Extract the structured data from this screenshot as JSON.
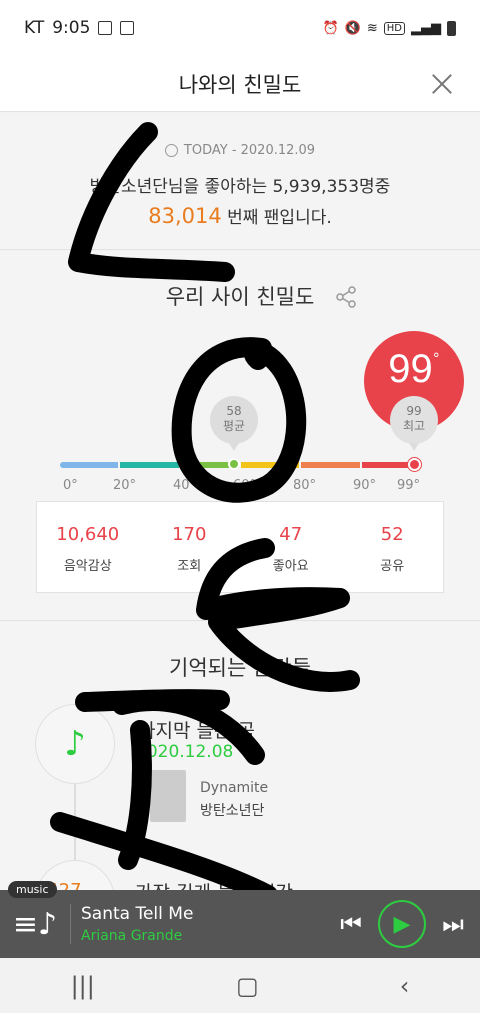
{
  "status_bar": {
    "carrier": "KT",
    "time": "9:05",
    "hd_badge": "HD"
  },
  "header": {
    "title": "나와의 친밀도"
  },
  "today": {
    "label": "TODAY - 2020.12.09",
    "line1": "방탄소년단님을 좋아하는 5,939,353명중",
    "rank": "83,014",
    "line2_suffix": "번째 팬입니다."
  },
  "intimacy": {
    "heading": "우리 사이 친밀도",
    "score": "99",
    "score_unit": "°",
    "avg_value": "58",
    "avg_label": "평균",
    "max_value": "99",
    "max_label": "최고",
    "avg_level": 58,
    "max_level": 99,
    "scale_colors": [
      "#7fb5e8",
      "#23b7a4",
      "#7ac143",
      "#f2c318",
      "#f07f4e",
      "#e8434a"
    ],
    "ticks": [
      "0°",
      "20°",
      "40°",
      "60°",
      "80°",
      "90°",
      "99°"
    ],
    "stats": [
      {
        "value": "10,640",
        "label": "음악감상"
      },
      {
        "value": "170",
        "label": "조회"
      },
      {
        "value": "47",
        "label": "좋아요"
      },
      {
        "value": "52",
        "label": "공유"
      }
    ]
  },
  "memory": {
    "heading": "기억되는 순간들",
    "item1_title": "마지막 들은 곡",
    "item1_date": "2020.12.08",
    "song_title": "Dynamite",
    "song_artist": "방탄소년단",
    "item2_num": "1,427",
    "item2_title": "가장 길게 들은 시간"
  },
  "player": {
    "tag": "music",
    "track_title": "Santa Tell Me",
    "track_artist": "Ariana Grande"
  },
  "colors": {
    "accent_red": "#e8434a",
    "accent_orange": "#e97c1e",
    "accent_green": "#2ecc40"
  }
}
